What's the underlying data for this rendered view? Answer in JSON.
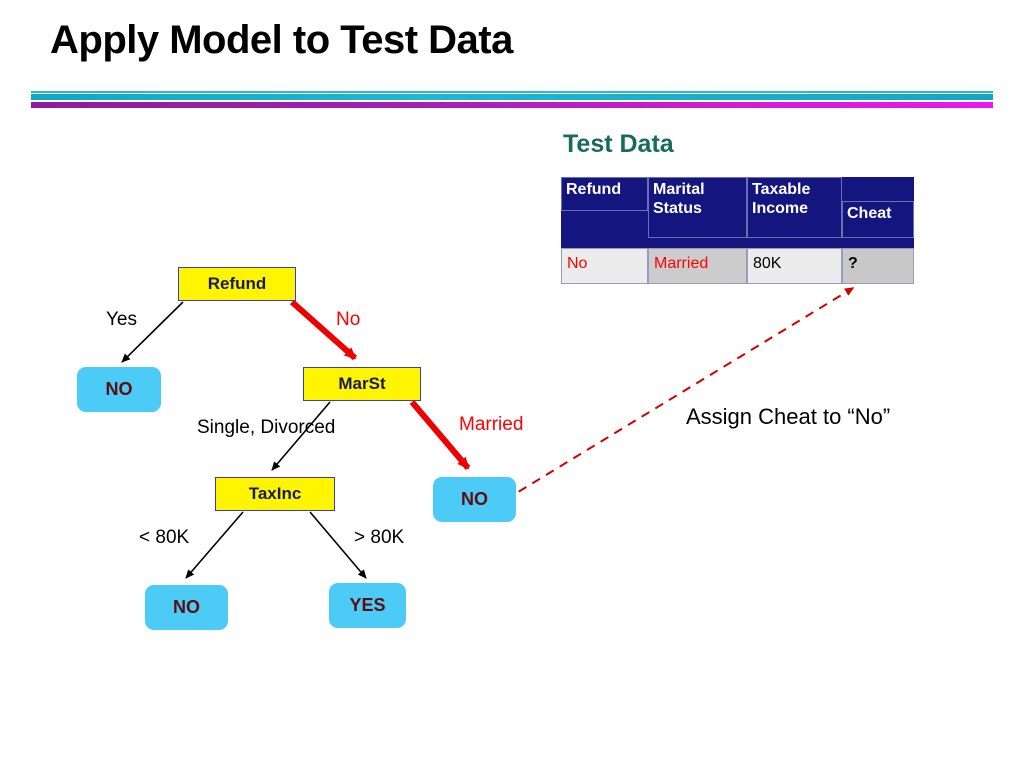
{
  "slide": {
    "title": "Apply Model to Test Data",
    "accent_teal": "#12A8C4",
    "accent_purple": "#C41AC4"
  },
  "test_data": {
    "caption": "Test Data",
    "caption_color": "#176B5C",
    "header_bg": "#151580",
    "columns": [
      "Refund",
      "Marital Status",
      "Taxable Income",
      "Cheat"
    ],
    "rows": [
      {
        "refund": "No",
        "marital_status": "Married",
        "taxable_income": "80K",
        "cheat": "?"
      }
    ]
  },
  "tree": {
    "nodes": [
      {
        "id": "refund",
        "label": "Refund",
        "type": "decision"
      },
      {
        "id": "marst",
        "label": "MarSt",
        "type": "decision"
      },
      {
        "id": "taxinc",
        "label": "TaxInc",
        "type": "decision"
      },
      {
        "id": "leaf-yes-no",
        "label": "NO",
        "type": "leaf"
      },
      {
        "id": "leaf-married-no",
        "label": "NO",
        "type": "leaf"
      },
      {
        "id": "leaf-lt80k-no",
        "label": "NO",
        "type": "leaf"
      },
      {
        "id": "leaf-gt80k-yes",
        "label": "YES",
        "type": "leaf"
      }
    ],
    "edge_labels": {
      "yes": "Yes",
      "no": "No",
      "single_divorced": "Single, Divorced",
      "married": "Married",
      "lt_80k": "< 80K",
      "gt_80k": "> 80K"
    },
    "node_fill": "#FFF500",
    "leaf_fill": "#4BCBF5",
    "highlight_color": "#FF0000"
  },
  "annotation": {
    "assign_text": "Assign Cheat to “No”"
  }
}
